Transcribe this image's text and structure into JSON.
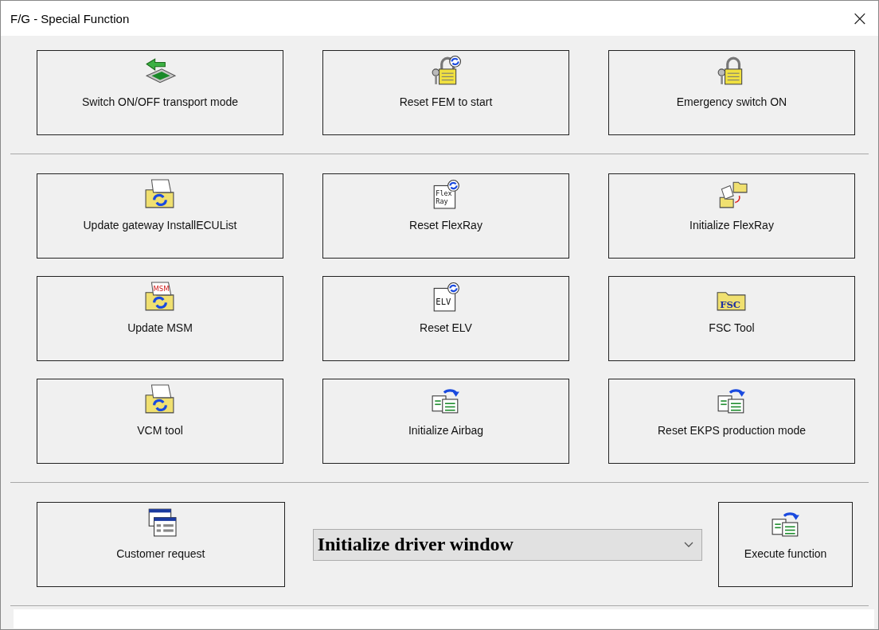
{
  "window": {
    "title": "F/G - Special Function",
    "close": "×"
  },
  "sections": [
    {
      "buttons": [
        {
          "label": "Switch ON/OFF transport mode",
          "kind": "transport"
        },
        {
          "label": "Reset FEM to start",
          "kind": "lockrefresh"
        },
        {
          "label": "Emergency switch ON",
          "kind": "lockkeys"
        }
      ]
    },
    {
      "buttons": [
        {
          "label": "Update gateway InstallECUList",
          "kind": "folderrefresh"
        },
        {
          "label": "Reset FlexRay",
          "kind": "docrefresh",
          "icon_text": [
            "Flex",
            "Ray"
          ]
        },
        {
          "label": "Initialize FlexRay",
          "kind": "foldersarrow"
        },
        {
          "label": "Update MSM",
          "kind": "folderrefresh",
          "icon_text": [
            "MSM"
          ]
        },
        {
          "label": "Reset ELV",
          "kind": "docrefresh",
          "icon_text": [
            "ELV"
          ]
        },
        {
          "label": "FSC Tool",
          "kind": "foldertext",
          "icon_text": [
            "FSC"
          ]
        },
        {
          "label": "VCM tool",
          "kind": "folderrefresh"
        },
        {
          "label": "Initialize Airbag",
          "kind": "cardsarrow"
        },
        {
          "label": "Reset EKPS production mode",
          "kind": "cardsarrow"
        }
      ]
    }
  ],
  "bottom": {
    "customer": {
      "label": "Customer request",
      "kind": "windows"
    },
    "function_select": {
      "value": "Initialize driver window"
    },
    "execute": {
      "label": "Execute function",
      "kind": "cardsarrow"
    }
  }
}
